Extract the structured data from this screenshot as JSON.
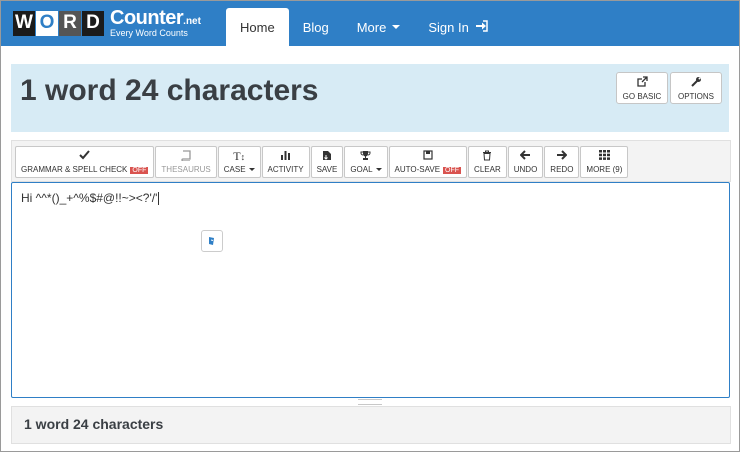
{
  "nav": {
    "logo_letters": [
      "W",
      "O",
      "R",
      "D"
    ],
    "logo_main": "Counter",
    "logo_net": ".net",
    "logo_tagline": "Every Word Counts",
    "links": [
      {
        "label": "Home",
        "active": true
      },
      {
        "label": "Blog"
      },
      {
        "label": "More"
      },
      {
        "label": "Sign In"
      }
    ]
  },
  "header": {
    "title": "1 word 24 characters",
    "buttons": [
      {
        "label": "GO BASIC",
        "icon": "external-link-icon"
      },
      {
        "label": "OPTIONS",
        "icon": "wrench-icon"
      }
    ]
  },
  "toolbar": {
    "items": [
      {
        "label": "GRAMMAR & SPELL CHECK",
        "icon": "check-icon",
        "badge": "OFF"
      },
      {
        "label": "THESAURUS",
        "icon": "book-icon"
      },
      {
        "label": "CASE",
        "icon": "text-case-icon"
      },
      {
        "label": "ACTIVITY",
        "icon": "bar-chart-icon"
      },
      {
        "label": "SAVE",
        "icon": "save-file-icon"
      },
      {
        "label": "GOAL",
        "icon": "trophy-icon"
      },
      {
        "label": "AUTO-SAVE",
        "icon": "floppy-icon",
        "badge": "OFF"
      },
      {
        "label": "CLEAR",
        "icon": "trash-icon"
      },
      {
        "label": "UNDO",
        "icon": "arrow-left-icon"
      },
      {
        "label": "REDO",
        "icon": "arrow-right-icon"
      },
      {
        "label": "MORE (9)",
        "icon": "grid-icon"
      }
    ]
  },
  "editor": {
    "text": "Hi ^^*()_+^%$#@!!~><?'/'"
  },
  "footer": {
    "summary": "1 word 24 characters"
  },
  "colors": {
    "nav": "#2f7fc6",
    "header_bg": "#d7ebf5",
    "off_badge": "#d9534f"
  }
}
